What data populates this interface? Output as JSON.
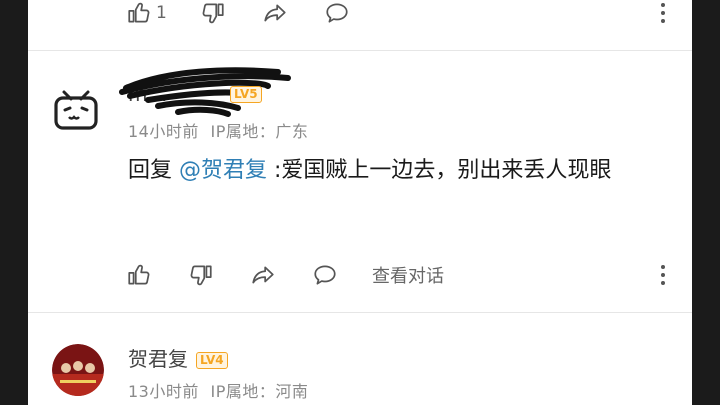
{
  "top_actions": {
    "like_count": "1"
  },
  "comment1": {
    "name": "m…",
    "time": "14小时前",
    "ip": "IP属地：广东",
    "reply_prefix": "回复",
    "mention": "@贺君复",
    "text": " :爱国贼上一边去，别出来丢人现眼",
    "view_conversation": "查看对话"
  },
  "comment2": {
    "name": "贺君复",
    "level": "LV4",
    "time": "13小时前",
    "ip": "IP属地：河南"
  },
  "colors": {
    "mention": "#2f7fb5",
    "level_badge": "#f5a623",
    "background": "#1b1b1b"
  }
}
